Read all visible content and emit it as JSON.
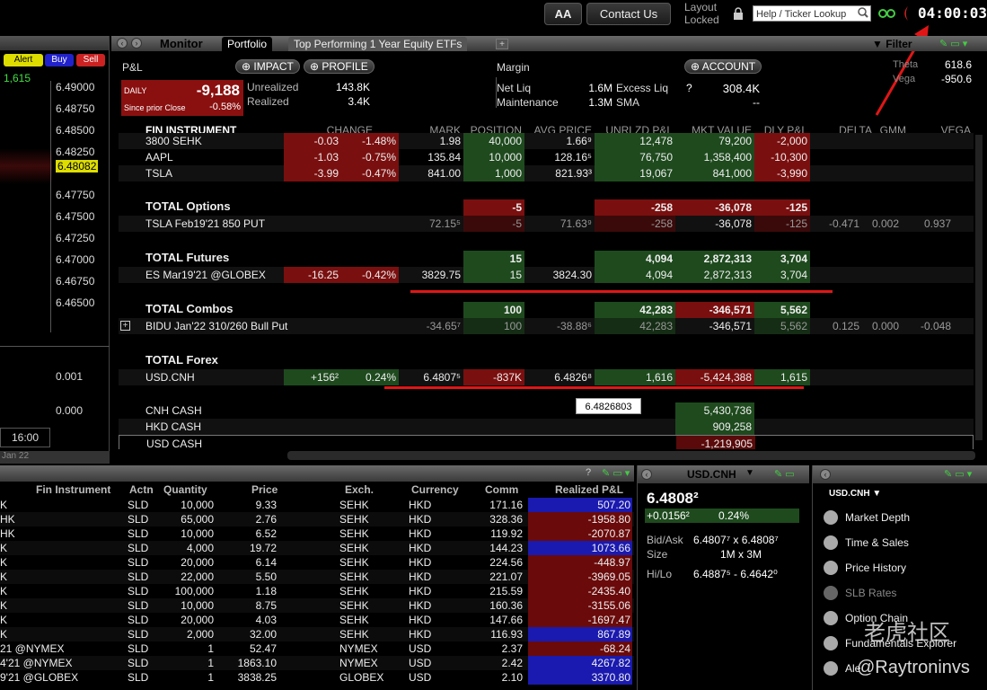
{
  "topbar": {
    "font_btn": "AA",
    "contact": "Contact Us",
    "layout": "Layout",
    "locked": "Locked",
    "help_placeholder": "Help / Ticker Lookup",
    "clock": "04:00:03"
  },
  "leftpanel": {
    "alert": "Alert",
    "buy": "Buy",
    "sell": "Sell",
    "top_value": "1,615",
    "prices": [
      "6.49000",
      "6.48750",
      "6.48500",
      "6.48250",
      "6.48000",
      "6.47750",
      "6.47500",
      "6.47250",
      "6.47000",
      "6.46750",
      "6.46500"
    ],
    "highlight_price": "6.48082",
    "ind1": "0.001",
    "ind2": "0.000",
    "time": "16:00",
    "date": "Jan 22"
  },
  "monitor": {
    "title": "Monitor",
    "tabs": [
      "Portfolio",
      "Top Performing 1 Year Equity ETFs"
    ],
    "filter": "Filter"
  },
  "pnl": {
    "label": "P&L",
    "impact": "IMPACT",
    "profile": "PROFILE",
    "daily": "DAILY",
    "daily_value": "-9,188",
    "since": "Since prior Close",
    "since_pct": "-0.58%",
    "unrealized_label": "Unrealized",
    "unrealized": "143.8K",
    "realized_label": "Realized",
    "realized": "3.4K"
  },
  "margin": {
    "label": "Margin",
    "account": "ACCOUNT",
    "netliq_label": "Net Liq",
    "netliq": "1.6M",
    "excess_label": "Excess Liq",
    "excess_q": "?",
    "excess": "308.4K",
    "maint_label": "Maintenance",
    "maint": "1.3M",
    "sma_label": "SMA",
    "sma": "--"
  },
  "greeks": {
    "theta_label": "Theta",
    "theta": "618.6",
    "vega_label": "Vega",
    "vega": "-950.6"
  },
  "grid": {
    "headers": [
      "FIN INSTRUMENT",
      "CHANGE",
      "MARK",
      "POSITION",
      "AVG PRICE",
      "UNRLZD P&L",
      "MKT VALUE",
      "DLY P&L",
      "DELTA",
      "GMM",
      "VEGA"
    ],
    "rows": [
      {
        "name": "3800 SEHK",
        "chg": "-0.03",
        "pct": "-1.48%",
        "mark": "1.98",
        "pos": "40,000",
        "avg": "1.66⁹",
        "upl": "12,478",
        "mkt": "79,200",
        "dly": "-2,000"
      },
      {
        "name": "AAPL",
        "chg": "-1.03",
        "pct": "-0.75%",
        "mark": "135.84",
        "pos": "10,000",
        "avg": "128.16⁵",
        "upl": "76,750",
        "mkt": "1,358,400",
        "dly": "-10,300"
      },
      {
        "name": "TSLA",
        "chg": "-3.99",
        "pct": "-0.47%",
        "mark": "841.00",
        "pos": "1,000",
        "avg": "821.93³",
        "upl": "19,067",
        "mkt": "841,000",
        "dly": "-3,990"
      },
      {
        "name": "TOTAL Options",
        "total": true,
        "pos": "-5",
        "upl": "-258",
        "mkt": "-36,078",
        "dly": "-125"
      },
      {
        "name": "TSLA Feb19'21 850 PUT",
        "mark": "72.15⁵",
        "pos": "-5",
        "avg": "71.63⁹",
        "upl": "-258",
        "mkt": "-36,078",
        "dly": "-125",
        "delta": "-0.471",
        "gmm": "0.002",
        "vega": "0.937"
      },
      {
        "name": "TOTAL Futures",
        "total": true,
        "pos": "15",
        "upl": "4,094",
        "mkt": "2,872,313",
        "dly": "3,704"
      },
      {
        "name": "ES Mar19'21 @GLOBEX",
        "chg": "-16.25",
        "pct": "-0.42%",
        "mark": "3829.75",
        "pos": "15",
        "avg": "3824.30",
        "upl": "4,094",
        "mkt": "2,872,313",
        "dly": "3,704"
      },
      {
        "name": "TOTAL Combos",
        "total": true,
        "pos": "100",
        "upl": "42,283",
        "mkt": "-346,571",
        "dly": "5,562"
      },
      {
        "name": "BIDU Jan'22 310/260 Bull Put",
        "mark": "-34.65⁷",
        "pos": "100",
        "avg": "-38.88⁶",
        "upl": "42,283",
        "mkt": "-346,571",
        "dly": "5,562",
        "delta": "0.125",
        "gmm": "0.000",
        "vega": "-0.048"
      },
      {
        "name": "TOTAL Forex",
        "total": true
      },
      {
        "name": "USD.CNH",
        "chg": "+156²",
        "pct": "0.24%",
        "mark": "6.4807⁵",
        "pos": "-837K",
        "avg": "6.4826⁸",
        "upl": "1,616",
        "mkt": "-5,424,388",
        "dly": "1,615"
      },
      {
        "name": "CNH CASH",
        "mkt": "5,430,736"
      },
      {
        "name": "HKD CASH",
        "mkt": "909,258"
      },
      {
        "name": "USD CASH",
        "mkt": "-1,219,905"
      }
    ],
    "tooltip": "6.4826803"
  },
  "trades": {
    "headers": [
      "Fin Instrument",
      "Actn",
      "Quantity",
      "Price",
      "Exch.",
      "Currency",
      "Comm",
      "Realized P&L"
    ],
    "rows": [
      [
        "K",
        "SLD",
        "10,000",
        "9.33",
        "SEHK",
        "HKD",
        "171.16",
        "507.20"
      ],
      [
        "HK",
        "SLD",
        "65,000",
        "2.76",
        "SEHK",
        "HKD",
        "328.36",
        "-1958.80"
      ],
      [
        "HK",
        "SLD",
        "10,000",
        "6.52",
        "SEHK",
        "HKD",
        "119.92",
        "-2070.87"
      ],
      [
        "K",
        "SLD",
        "4,000",
        "19.72",
        "SEHK",
        "HKD",
        "144.23",
        "1073.66"
      ],
      [
        "K",
        "SLD",
        "20,000",
        "6.14",
        "SEHK",
        "HKD",
        "224.56",
        "-448.97"
      ],
      [
        "K",
        "SLD",
        "22,000",
        "5.50",
        "SEHK",
        "HKD",
        "221.07",
        "-3969.05"
      ],
      [
        "K",
        "SLD",
        "100,000",
        "1.18",
        "SEHK",
        "HKD",
        "215.59",
        "-2435.40"
      ],
      [
        "K",
        "SLD",
        "10,000",
        "8.75",
        "SEHK",
        "HKD",
        "160.36",
        "-3155.06"
      ],
      [
        "K",
        "SLD",
        "20,000",
        "4.03",
        "SEHK",
        "HKD",
        "147.66",
        "-1697.47"
      ],
      [
        "K",
        "SLD",
        "2,000",
        "32.00",
        "SEHK",
        "HKD",
        "116.93",
        "867.89"
      ],
      [
        "21 @NYMEX",
        "SLD",
        "1",
        "52.47",
        "NYMEX",
        "USD",
        "2.37",
        "-68.24"
      ],
      [
        "4'21 @NYMEX",
        "SLD",
        "1",
        "1863.10",
        "NYMEX",
        "USD",
        "2.42",
        "4267.82"
      ],
      [
        "9'21 @GLOBEX",
        "SLD",
        "1",
        "3838.25",
        "GLOBEX",
        "USD",
        "2.10",
        "3370.80"
      ]
    ]
  },
  "quote": {
    "symbol": "USD.CNH",
    "last": "6.4808²",
    "change": "+0.0156²",
    "change_pct": "0.24%",
    "bidask_label": "Bid/Ask",
    "bidask": "6.4807⁷ x 6.4808⁷",
    "size_label": "Size",
    "size": "1M x 3M",
    "hilo_label": "Hi/Lo",
    "hilo": "6.4887⁵ - 6.4642⁰"
  },
  "tools": {
    "symbol": "USD.CNH",
    "items": [
      "Market Depth",
      "Time & Sales",
      "Price History",
      "SLB Rates",
      "Option Chain",
      "Fundamentals Explorer",
      "Ale"
    ]
  },
  "watermark": {
    "text1": "老虎社区",
    "text2": "@Raytroninvs"
  },
  "colors": {
    "red": "#7a0f0f",
    "green": "#1e4a1e",
    "blue": "#1a1aa0",
    "accent_red": "#e01616"
  }
}
